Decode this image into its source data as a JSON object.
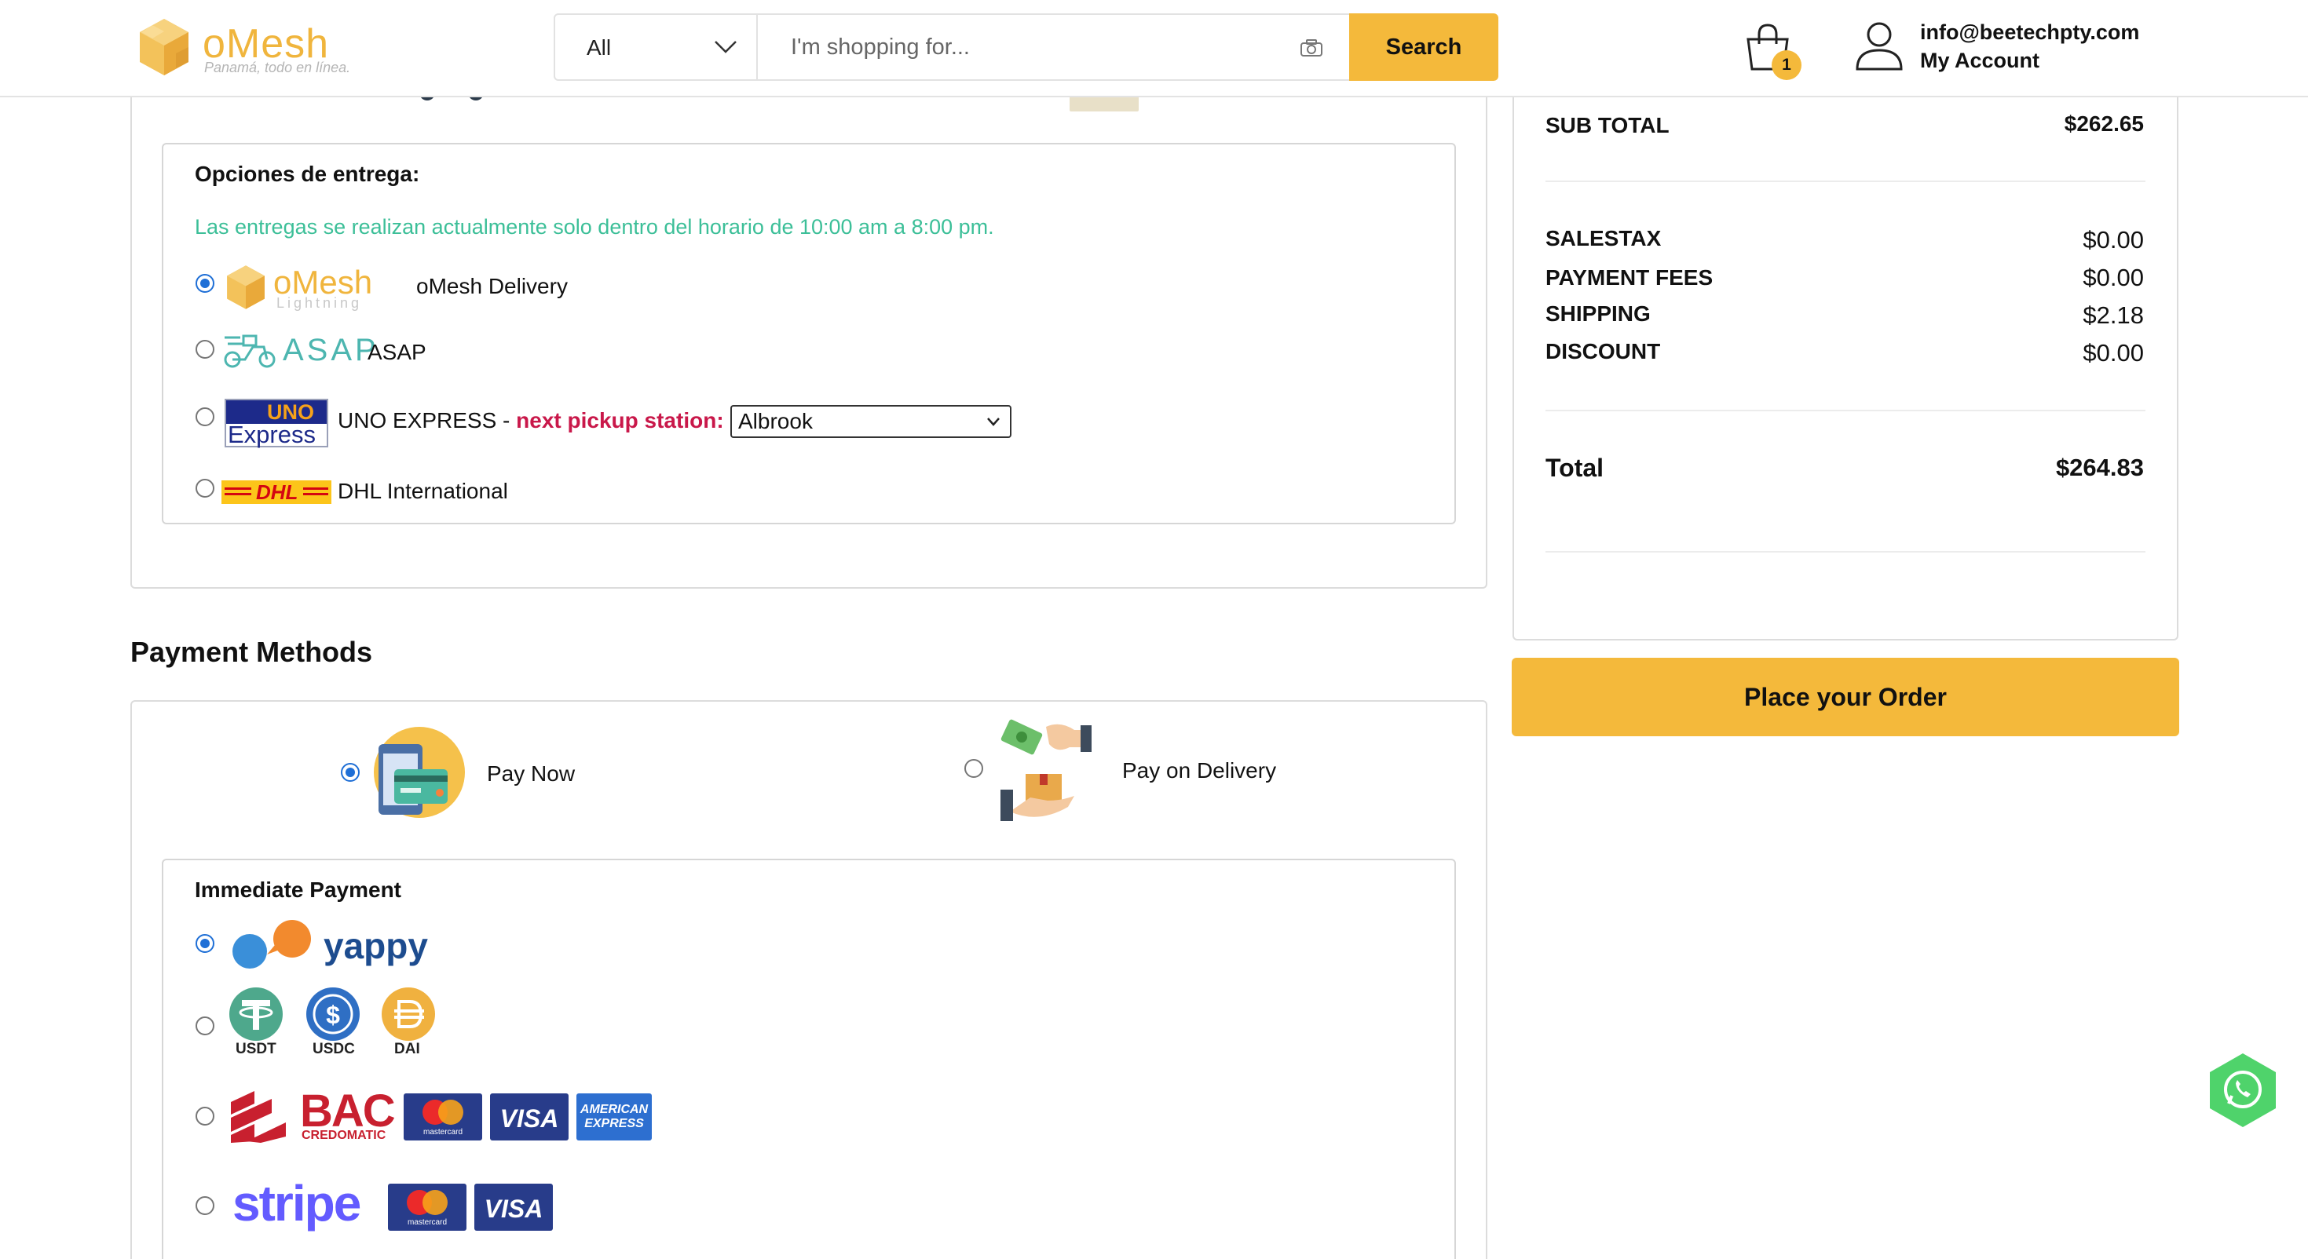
{
  "header": {
    "logo": {
      "name": "oMesh",
      "tagline": "Panamá, todo en línea."
    },
    "search": {
      "category": "All",
      "placeholder": "I'm shopping for...",
      "button_label": "Search"
    },
    "cart": {
      "count": "1"
    },
    "account": {
      "email": "info@beetechpty.com",
      "label": "My Account"
    }
  },
  "delivery": {
    "title": "Opciones de entrega:",
    "note": "Las entregas se realizan actualmente solo dentro del horario de 10:00 am a 8:00 pm.",
    "options": [
      {
        "logo_text": "oMesh",
        "logo_sub": "Lightning",
        "label": "oMesh Delivery",
        "selected": true
      },
      {
        "logo_text": "ASAP",
        "label": "ASAP",
        "selected": false
      },
      {
        "logo_top": "UNO",
        "logo_bottom": "Express",
        "label": "UNO EXPRESS - ",
        "highlight": "next pickup station:",
        "station": "Albrook",
        "selected": false
      },
      {
        "logo_text": "DHL",
        "label": "DHL International",
        "selected": false
      }
    ]
  },
  "payment": {
    "title": "Payment Methods",
    "modes": [
      {
        "label": "Pay Now",
        "selected": true
      },
      {
        "label": "Pay on Delivery",
        "selected": false
      }
    ],
    "immediate": {
      "title": "Immediate Payment",
      "methods": [
        {
          "id": "yappy",
          "logo_text": "yappy",
          "selected": true
        },
        {
          "id": "crypto",
          "coins": [
            "USDT",
            "USDC",
            "DAI"
          ],
          "selected": false
        },
        {
          "id": "bac",
          "logo_text": "BAC",
          "logo_sub": "CREDOMATIC",
          "cards": [
            "mastercard",
            "VISA",
            "AMERICAN EXPRESS"
          ],
          "selected": false
        },
        {
          "id": "stripe",
          "logo_text": "stripe",
          "cards": [
            "mastercard",
            "VISA"
          ],
          "selected": false
        }
      ]
    }
  },
  "summary": {
    "subtotal": {
      "label": "SUB TOTAL",
      "value": "$262.65"
    },
    "salestax": {
      "label": "SALESTAX",
      "value": "$0.00"
    },
    "payment_fees": {
      "label": "PAYMENT FEES",
      "value": "$0.00"
    },
    "shipping": {
      "label": "SHIPPING",
      "value": "$2.18"
    },
    "discount": {
      "label": "DISCOUNT",
      "value": "$0.00"
    },
    "total": {
      "label": "Total",
      "value": "$264.83"
    },
    "place_order_label": "Place your Order"
  },
  "colors": {
    "accent": "#f4b93b",
    "note_green": "#3cbf98",
    "highlight_red": "#c9184a",
    "radio_blue": "#1f6fd6",
    "whatsapp_green": "#4fd36b"
  }
}
